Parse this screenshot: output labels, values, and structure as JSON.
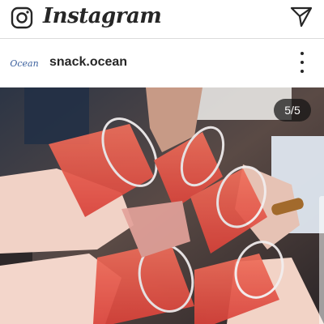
{
  "app_bar": {
    "logo_text": "Instagram",
    "camera_icon": "camera-icon",
    "direct_icon": "paper-plane-icon"
  },
  "post": {
    "username": "snack.ocean",
    "avatar_text": "Ocean",
    "more_icon": "vertical-dots-icon",
    "carousel_counter": "5/5",
    "image_description_icon": "photo"
  },
  "colors": {
    "text": "#262626",
    "divider": "#dbdbdb",
    "drink": "#e8584a",
    "counter_bg": "#141414"
  }
}
